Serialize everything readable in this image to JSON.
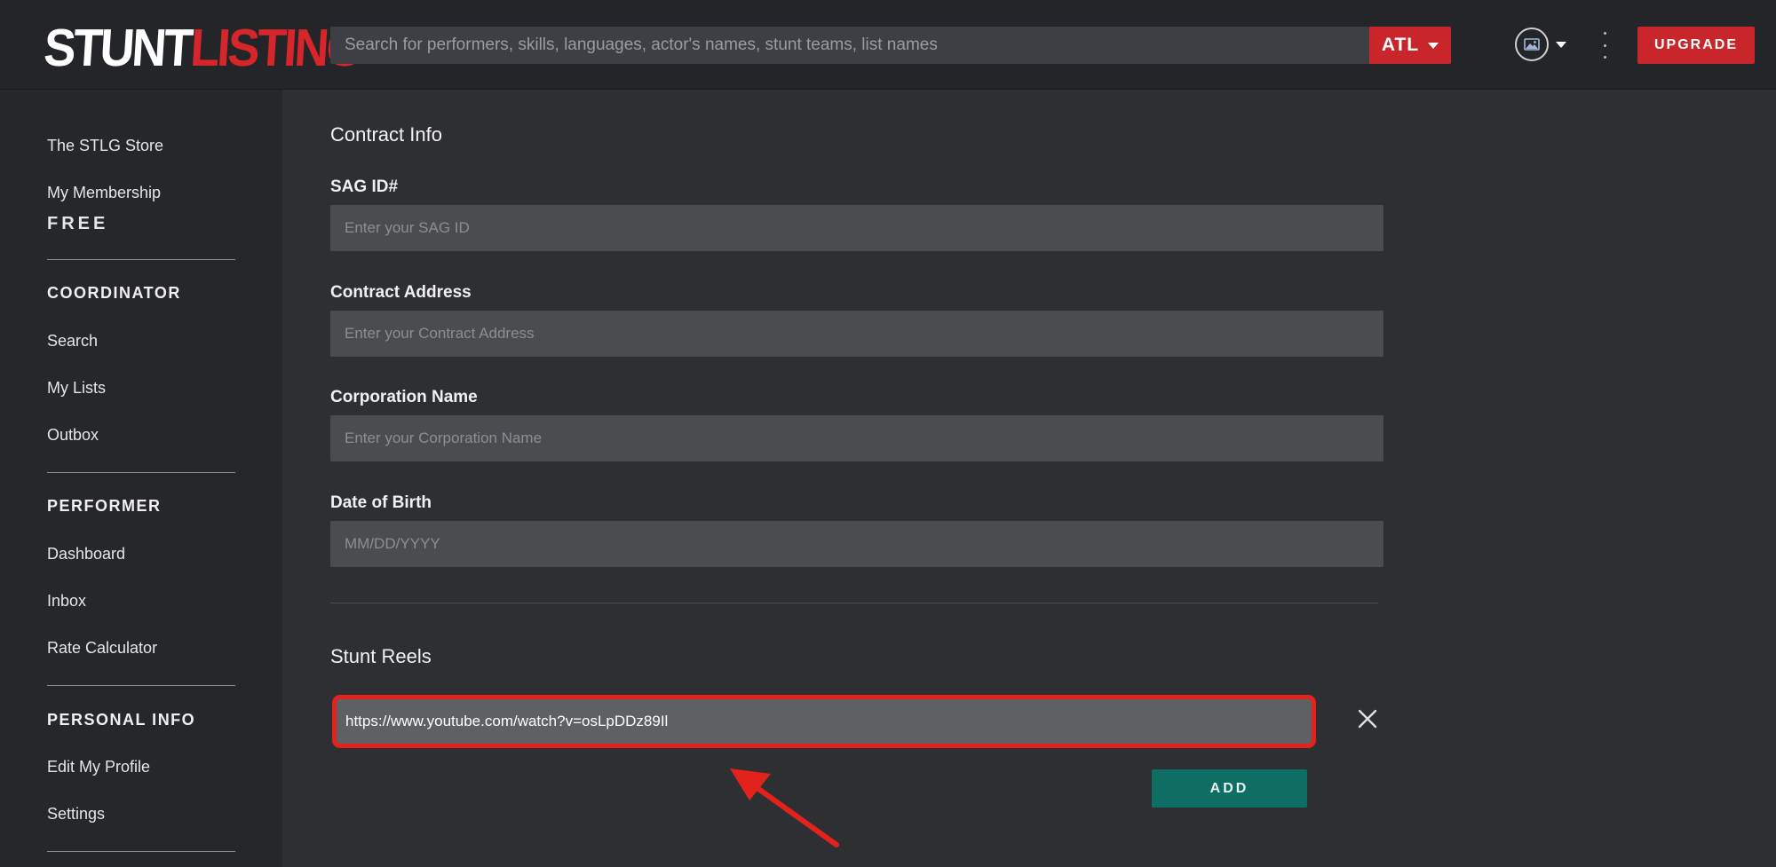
{
  "header": {
    "logo_part1": "STUNT",
    "logo_part2": "LISTING",
    "search_placeholder": "Search for performers, skills, languages, actor's names, stunt teams, list names",
    "location": "ATL",
    "upgrade_label": "UPGRADE"
  },
  "sidebar": {
    "store": "The STLG Store",
    "membership": "My Membership",
    "membership_tier": "FREE",
    "coordinator": {
      "heading": "COORDINATOR",
      "items": [
        "Search",
        "My Lists",
        "Outbox"
      ]
    },
    "performer": {
      "heading": "PERFORMER",
      "items": [
        "Dashboard",
        "Inbox",
        "Rate Calculator"
      ]
    },
    "personal": {
      "heading": "PERSONAL INFO",
      "items": [
        "Edit My Profile",
        "Settings"
      ]
    }
  },
  "contract": {
    "title": "Contract Info",
    "fields": [
      {
        "label": "SAG ID#",
        "placeholder": "Enter your SAG ID",
        "value": ""
      },
      {
        "label": "Contract Address",
        "placeholder": "Enter your Contract Address",
        "value": ""
      },
      {
        "label": "Corporation Name",
        "placeholder": "Enter your Corporation Name",
        "value": ""
      },
      {
        "label": "Date of Birth",
        "placeholder": "MM/DD/YYYY",
        "value": ""
      }
    ]
  },
  "reels": {
    "title": "Stunt Reels",
    "value": "https://www.youtube.com/watch?v=osLpDDz89Il",
    "add_label": "ADD"
  },
  "colors": {
    "accent_red": "#c8262b",
    "highlight_red": "#e3221c",
    "add_teal": "#0f6e63"
  },
  "icons": [
    "image-avatar-icon",
    "chevron-down-icon",
    "more-vertical-icon",
    "close-icon",
    "annotation-arrow"
  ]
}
